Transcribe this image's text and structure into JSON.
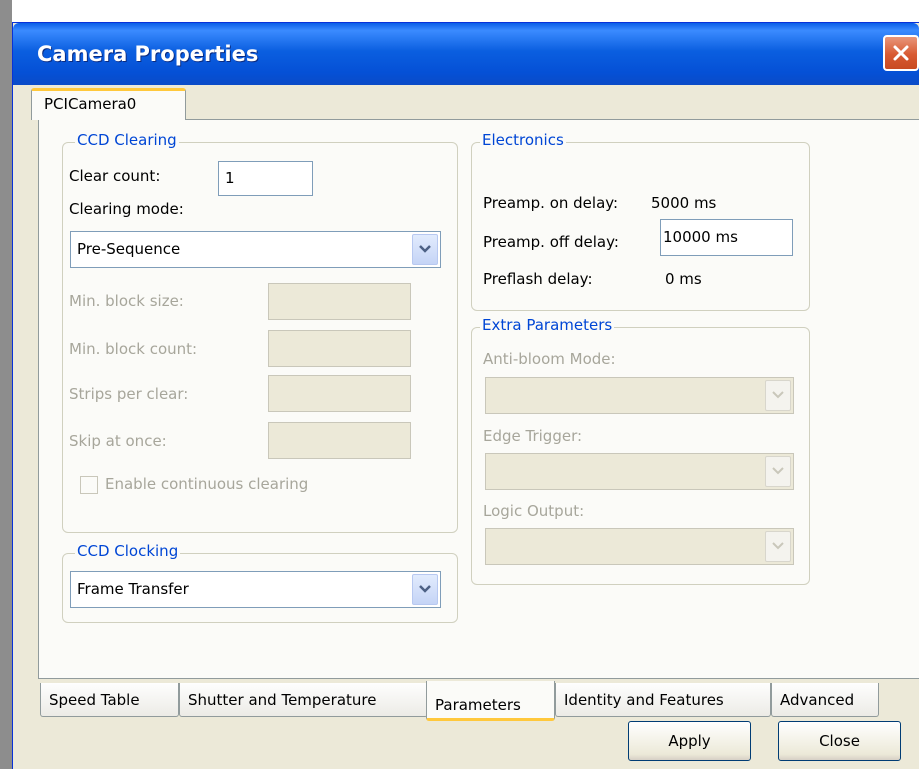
{
  "window": {
    "title": "Camera Properties"
  },
  "top_tab": {
    "label": "PCICamera0"
  },
  "ccd_clearing": {
    "legend": "CCD Clearing",
    "clear_count_label": "Clear count:",
    "clear_count_value": "1",
    "clearing_mode_label": "Clearing mode:",
    "clearing_mode_value": "Pre-Sequence",
    "min_block_size_label": "Min. block size:",
    "min_block_count_label": "Min. block count:",
    "strips_per_clear_label": "Strips per clear:",
    "skip_at_once_label": "Skip at once:",
    "continuous_label": "Enable continuous clearing",
    "continuous_checked": false
  },
  "ccd_clocking": {
    "legend": "CCD Clocking",
    "value": "Frame Transfer"
  },
  "electronics": {
    "legend": "Electronics",
    "preamp_on_label": "Preamp. on delay:",
    "preamp_on_value": "5000 ms",
    "preamp_off_label": "Preamp. off delay:",
    "preamp_off_value": "10000 ms",
    "preflash_label": "Preflash delay:",
    "preflash_value": "0 ms"
  },
  "extra": {
    "legend": "Extra Parameters",
    "anti_bloom_label": "Anti-bloom Mode:",
    "edge_trigger_label": "Edge Trigger:",
    "logic_output_label": "Logic Output:"
  },
  "bottom_tabs": [
    {
      "label": "Speed Table"
    },
    {
      "label": "Shutter and Temperature"
    },
    {
      "label": "Parameters"
    },
    {
      "label": "Identity and Features"
    },
    {
      "label": "Advanced"
    }
  ],
  "active_bottom_tab": "Parameters",
  "buttons": {
    "apply": "Apply",
    "close": "Close"
  },
  "colors": {
    "title_bar": "#0a5ee8",
    "group_legend": "#0046d5",
    "tab_highlight": "#ffc83c",
    "close_button": "#d85a32"
  },
  "icons": {
    "close": "close-x-icon",
    "combo_arrow": "chevron-down-icon"
  }
}
